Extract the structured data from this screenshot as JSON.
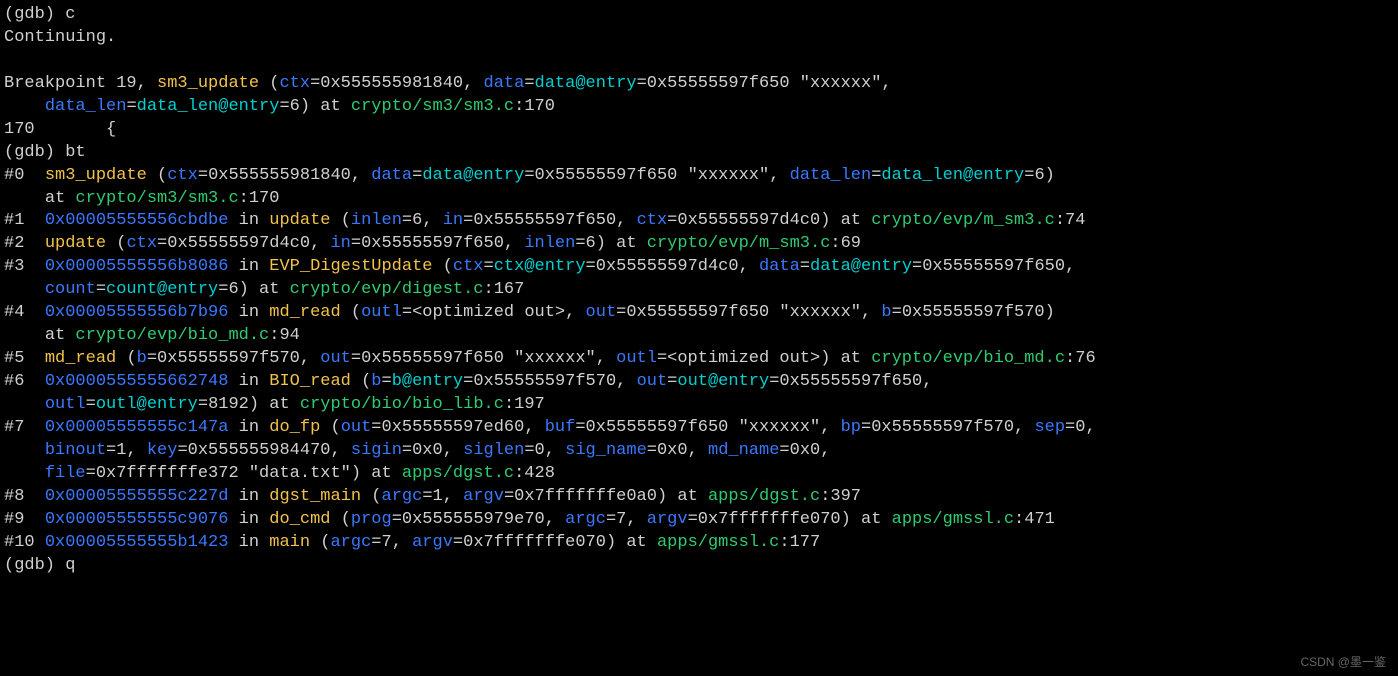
{
  "eq": "=",
  "cm": ",",
  "op": "(",
  "cp": ")",
  "cpat": ") at",
  "at": "at",
  "in": "in",
  "wm": "CSDN @墨一鉴",
  "l1": {
    "prompt": "(gdb)",
    "cmd": "c"
  },
  "l2": "Continuing.",
  "l4": {
    "a": "Breakpoint 19,",
    "fn": "sm3_update",
    "op1": "(",
    "p1": "ctx",
    "v1": "0x555555981840",
    "p2": "data",
    "de": "data@entry",
    "v2": "0x55555597f650 \"xxxxxx\""
  },
  "l5": {
    "p1": "data_len",
    "e1": "data_len@entry",
    "v1": "6",
    "at": ") at ",
    "path": "crypto/sm3/sm3.c",
    "ln": ":170"
  },
  "l6": "170       {",
  "l7": {
    "prompt": "(gdb)",
    "cmd": "bt"
  },
  "f0": {
    "n": "#0",
    "fn": "sm3_update",
    "p1": "ctx",
    "v1": "0x555555981840",
    "p2": "data",
    "e2": "data@entry",
    "v2": "0x55555597f650 \"xxxxxx\"",
    "p3": "data_len",
    "e3": "data_len@entry",
    "v3": "6",
    "path": "crypto/sm3/sm3.c",
    "ln": ":170"
  },
  "f1": {
    "n": "#1",
    "addr": "0x00005555556cbdbe",
    "fn": "update",
    "p1": "inlen",
    "v1": "6",
    "p2": "in",
    "v2": "0x55555597f650",
    "p3": "ctx",
    "v3": "0x55555597d4c0",
    "path": "crypto/evp/m_sm3.c",
    "ln": ":74"
  },
  "f2": {
    "n": "#2",
    "fn": "update",
    "p1": "ctx",
    "v1": "0x55555597d4c0",
    "p2": "in",
    "v2": "0x55555597f650",
    "p3": "inlen",
    "v3": "6",
    "path": "crypto/evp/m_sm3.c",
    "ln": ":69"
  },
  "f3": {
    "n": "#3",
    "addr": "0x00005555556b8086",
    "fn": "EVP_DigestUpdate",
    "p1": "ctx",
    "e1": "ctx@entry",
    "v1": "0x55555597d4c0",
    "p2": "data",
    "e2": "data@entry",
    "v2": "0x55555597f650",
    "p3": "count",
    "e3": "count@entry",
    "v3": "6",
    "path": "crypto/evp/digest.c",
    "ln": ":167"
  },
  "f4": {
    "n": "#4",
    "addr": "0x00005555556b7b96",
    "fn": "md_read",
    "p1": "outl",
    "v1": "<optimized out>",
    "p2": "out",
    "v2": "0x55555597f650 \"xxxxxx\"",
    "p3": "b",
    "v3": "0x55555597f570",
    "path": "crypto/evp/bio_md.c",
    "ln": ":94"
  },
  "f5": {
    "n": "#5",
    "fn": "md_read",
    "p1": "b",
    "v1": "0x55555597f570",
    "p2": "out",
    "v2": "0x55555597f650 \"xxxxxx\"",
    "p3": "outl",
    "v3": "<optimized out>",
    "path": "crypto/evp/bio_md.c",
    "ln": ":76"
  },
  "f6": {
    "n": "#6",
    "addr": "0x0000555555662748",
    "fn": "BIO_read",
    "p1": "b",
    "e1": "b@entry",
    "v1": "0x55555597f570",
    "p2": "out",
    "e2": "out@entry",
    "v2": "0x55555597f650",
    "p3": "outl",
    "e3": "outl@entry",
    "v3": "8192",
    "path": "crypto/bio/bio_lib.c",
    "ln": ":197"
  },
  "f7": {
    "n": "#7",
    "addr": "0x00005555555c147a",
    "fn": "do_fp",
    "p1": "out",
    "v1": "0x55555597ed60",
    "p2": "buf",
    "v2": "0x55555597f650 \"xxxxxx\"",
    "p3": "bp",
    "v3": "0x55555597f570",
    "p4": "sep",
    "v4": "0",
    "p5": "binout",
    "v5": "1",
    "p6": "key",
    "v6": "0x555555984470",
    "p7": "sigin",
    "v7": "0x0",
    "p8": "siglen",
    "v8": "0",
    "p9": "sig_name",
    "v9": "0x0",
    "p10": "md_name",
    "v10": "0x0",
    "p11": "file",
    "v11": "0x7fffffffe372 \"data.txt\"",
    "path": "apps/dgst.c",
    "ln": ":428"
  },
  "f8": {
    "n": "#8",
    "addr": "0x00005555555c227d",
    "fn": "dgst_main",
    "p1": "argc",
    "v1": "1",
    "p2": "argv",
    "v2": "0x7fffffffe0a0",
    "path": "apps/dgst.c",
    "ln": ":397"
  },
  "f9": {
    "n": "#9",
    "addr": "0x00005555555c9076",
    "fn": "do_cmd",
    "p1": "prog",
    "v1": "0x555555979e70",
    "p2": "argc",
    "v2": "7",
    "p3": "argv",
    "v3": "0x7fffffffe070",
    "path": "apps/gmssl.c",
    "ln": ":471"
  },
  "f10": {
    "n": "#10",
    "addr": "0x00005555555b1423",
    "fn": "main",
    "p1": "argc",
    "v1": "7",
    "p2": "argv",
    "v2": "0x7fffffffe070",
    "path": "apps/gmssl.c",
    "ln": ":177"
  },
  "lq": {
    "prompt": "(gdb)",
    "cmd": "q"
  }
}
